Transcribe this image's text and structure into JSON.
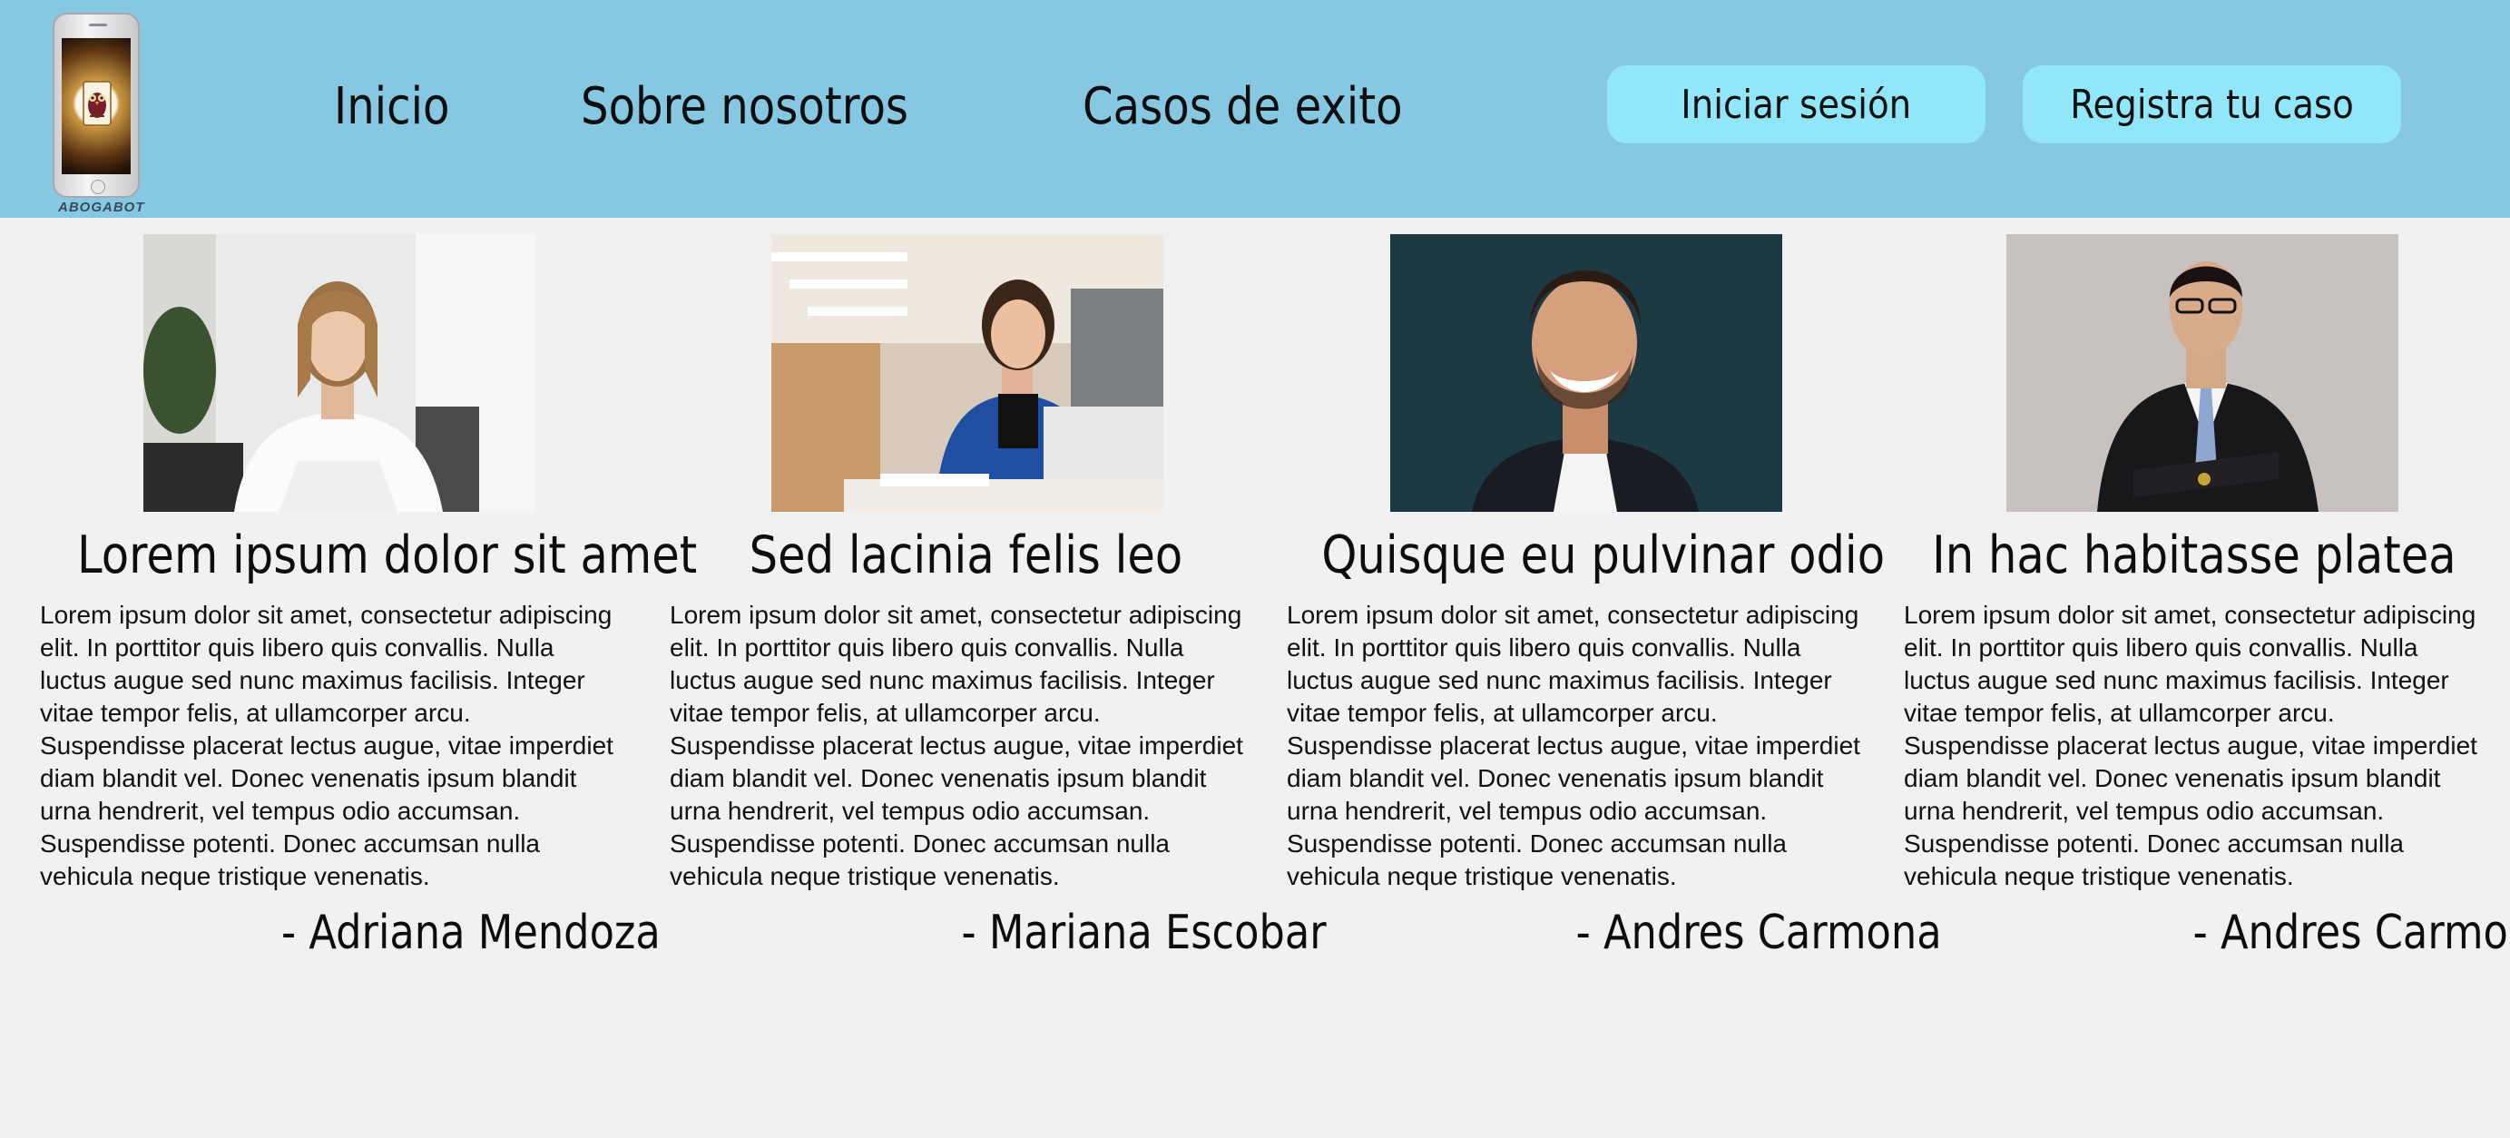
{
  "header": {
    "logo_text": "ABOGABOT",
    "nav": [
      "Inicio",
      "Sobre nosotros",
      "Casos de exito"
    ],
    "login_label": "Iniciar sesión",
    "register_label": "Registra tu caso"
  },
  "colors": {
    "header_bg": "#86c8e2",
    "button_bg": "#92e6f9",
    "page_bg": "#f1f1f1"
  },
  "testimonials": [
    {
      "title": "Lorem ipsum dolor sit amet",
      "body": "Lorem ipsum dolor sit amet, consectetur adipiscing elit. In porttitor quis libero quis convallis. Nulla luctus augue sed nunc maximus facilisis. Integer vitae tempor felis, at ullamcorper arcu. Suspendisse placerat lectus augue, vitae imperdiet diam blandit vel. Donec venenatis ipsum blandit urna hendrerit, vel tempus odio accumsan. Suspendisse potenti. Donec accumsan nulla vehicula neque tristique venenatis.",
      "author": "- Adriana Mendoza"
    },
    {
      "title": "Sed lacinia felis leo",
      "body": "Lorem ipsum dolor sit amet, consectetur adipiscing elit. In porttitor quis libero quis convallis. Nulla luctus augue sed nunc maximus facilisis. Integer vitae tempor felis, at ullamcorper arcu. Suspendisse placerat lectus augue, vitae imperdiet diam blandit vel. Donec venenatis ipsum blandit urna hendrerit, vel tempus odio accumsan. Suspendisse potenti. Donec accumsan nulla vehicula neque tristique venenatis.",
      "author": "- Mariana Escobar"
    },
    {
      "title": "Quisque eu pulvinar odio",
      "body": "Lorem ipsum dolor sit amet, consectetur adipiscing elit. In porttitor quis libero quis convallis. Nulla luctus augue sed nunc maximus facilisis. Integer vitae tempor felis, at ullamcorper arcu. Suspendisse placerat lectus augue, vitae imperdiet diam blandit vel. Donec venenatis ipsum blandit urna hendrerit, vel tempus odio accumsan. Suspendisse potenti. Donec accumsan nulla vehicula neque tristique venenatis.",
      "author": "- Andres Carmona"
    },
    {
      "title": "In hac habitasse platea",
      "body": "Lorem ipsum dolor sit amet, consectetur adipiscing elit. In porttitor quis libero quis convallis. Nulla luctus augue sed nunc maximus facilisis. Integer vitae tempor felis, at ullamcorper arcu. Suspendisse placerat lectus augue, vitae imperdiet diam blandit vel. Donec venenatis ipsum blandit urna hendrerit, vel tempus odio accumsan. Suspendisse potenti. Donec accumsan nulla vehicula neque tristique venenatis.",
      "author": "- Andres Carmona"
    }
  ]
}
